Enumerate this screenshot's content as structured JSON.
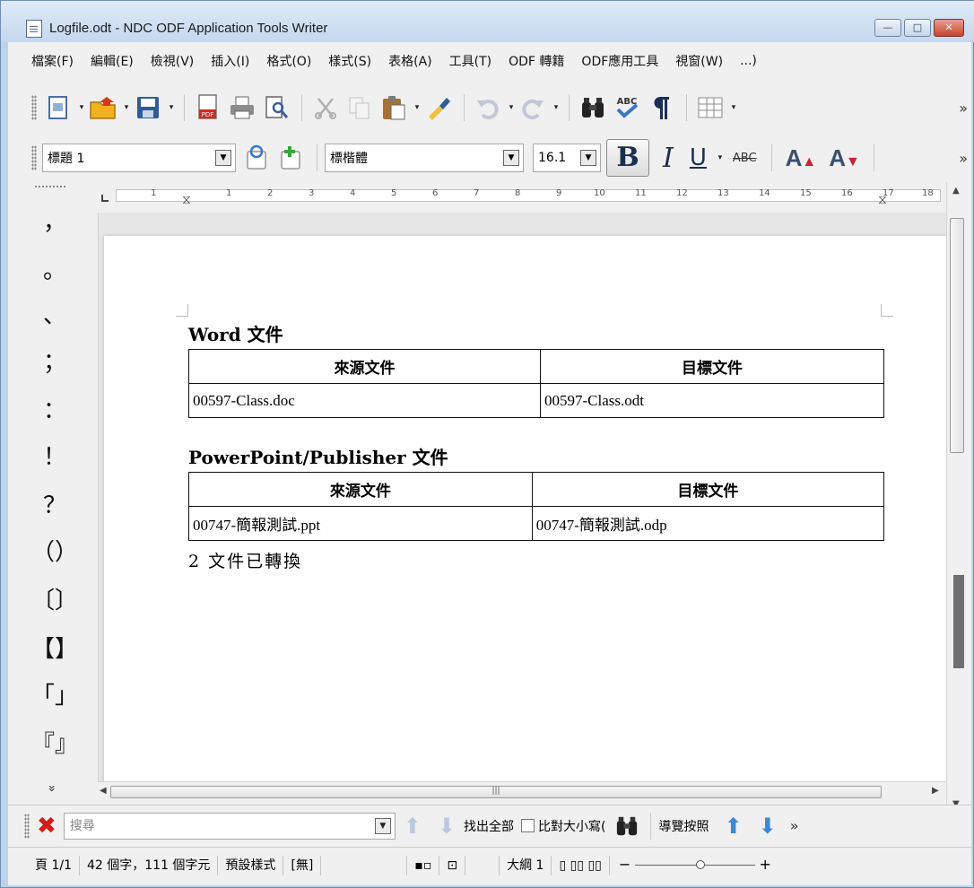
{
  "window": {
    "title": "Logfile.odt - NDC ODF Application Tools Writer",
    "minimize_label": "—",
    "maximize_label": "□",
    "close_label": "✕"
  },
  "menubar": {
    "items": [
      "檔案(F)",
      "編輯(E)",
      "檢視(V)",
      "插入(I)",
      "格式(O)",
      "樣式(S)",
      "表格(A)",
      "工具(T)",
      "ODF 轉籍",
      "ODF應用工具",
      "視窗(W)",
      "...)"
    ]
  },
  "toolbar_standard": {
    "icons": [
      "new-document-icon",
      "open-folder-icon",
      "save-icon",
      "export-pdf-icon",
      "print-icon",
      "print-preview-icon",
      "cut-icon",
      "copy-icon",
      "paste-icon",
      "clone-formatting-icon",
      "undo-icon",
      "redo-icon",
      "find-replace-icon",
      "spellcheck-icon",
      "formatting-marks-icon",
      "insert-table-icon"
    ],
    "overflow": "»"
  },
  "toolbar_formatting": {
    "paragraph_style": "標題 1",
    "font_name": "標楷體",
    "font_size": "16.1",
    "bold_label": "B",
    "italic_label": "I",
    "underline_label": "U",
    "strikethrough_label": "ABC",
    "grow_font_label": "A",
    "shrink_font_label": "A",
    "overflow": "»"
  },
  "char_panel": {
    "chars": [
      "，",
      "。",
      "、",
      "；",
      "：",
      "！",
      "？",
      "（）",
      "〔〕",
      "【】",
      "「」",
      "『』"
    ],
    "more": "»"
  },
  "ruler": {
    "numbers": [
      "1",
      "1",
      "2",
      "3",
      "4",
      "5",
      "6",
      "7",
      "8",
      "9",
      "10",
      "11",
      "12",
      "13",
      "14",
      "15",
      "16",
      "17",
      "18"
    ]
  },
  "document": {
    "sections": [
      {
        "heading": "Word 文件",
        "headers": [
          "來源文件",
          "目標文件"
        ],
        "rows": [
          [
            "00597-Class.doc",
            "00597-Class.odt"
          ]
        ]
      },
      {
        "heading": "PowerPoint/Publisher 文件",
        "headers": [
          "來源文件",
          "目標文件"
        ],
        "rows": [
          [
            "00747-簡報測試.ppt",
            "00747-簡報測試.odp"
          ]
        ]
      }
    ],
    "summary": "2 文件已轉換"
  },
  "findbar": {
    "placeholder": "搜尋",
    "find_all": "找出全部",
    "match_case": "比對大小寫(",
    "navigator": "導覽按照",
    "overflow": "»"
  },
  "statusbar": {
    "page": "頁 1/1",
    "counts": "42 個字，111 個字元",
    "page_style": "預設樣式",
    "language": "[無]",
    "outline": "大綱 1",
    "zoom_minus": "−",
    "zoom_plus": "+",
    "zoom_level": 0.55
  }
}
